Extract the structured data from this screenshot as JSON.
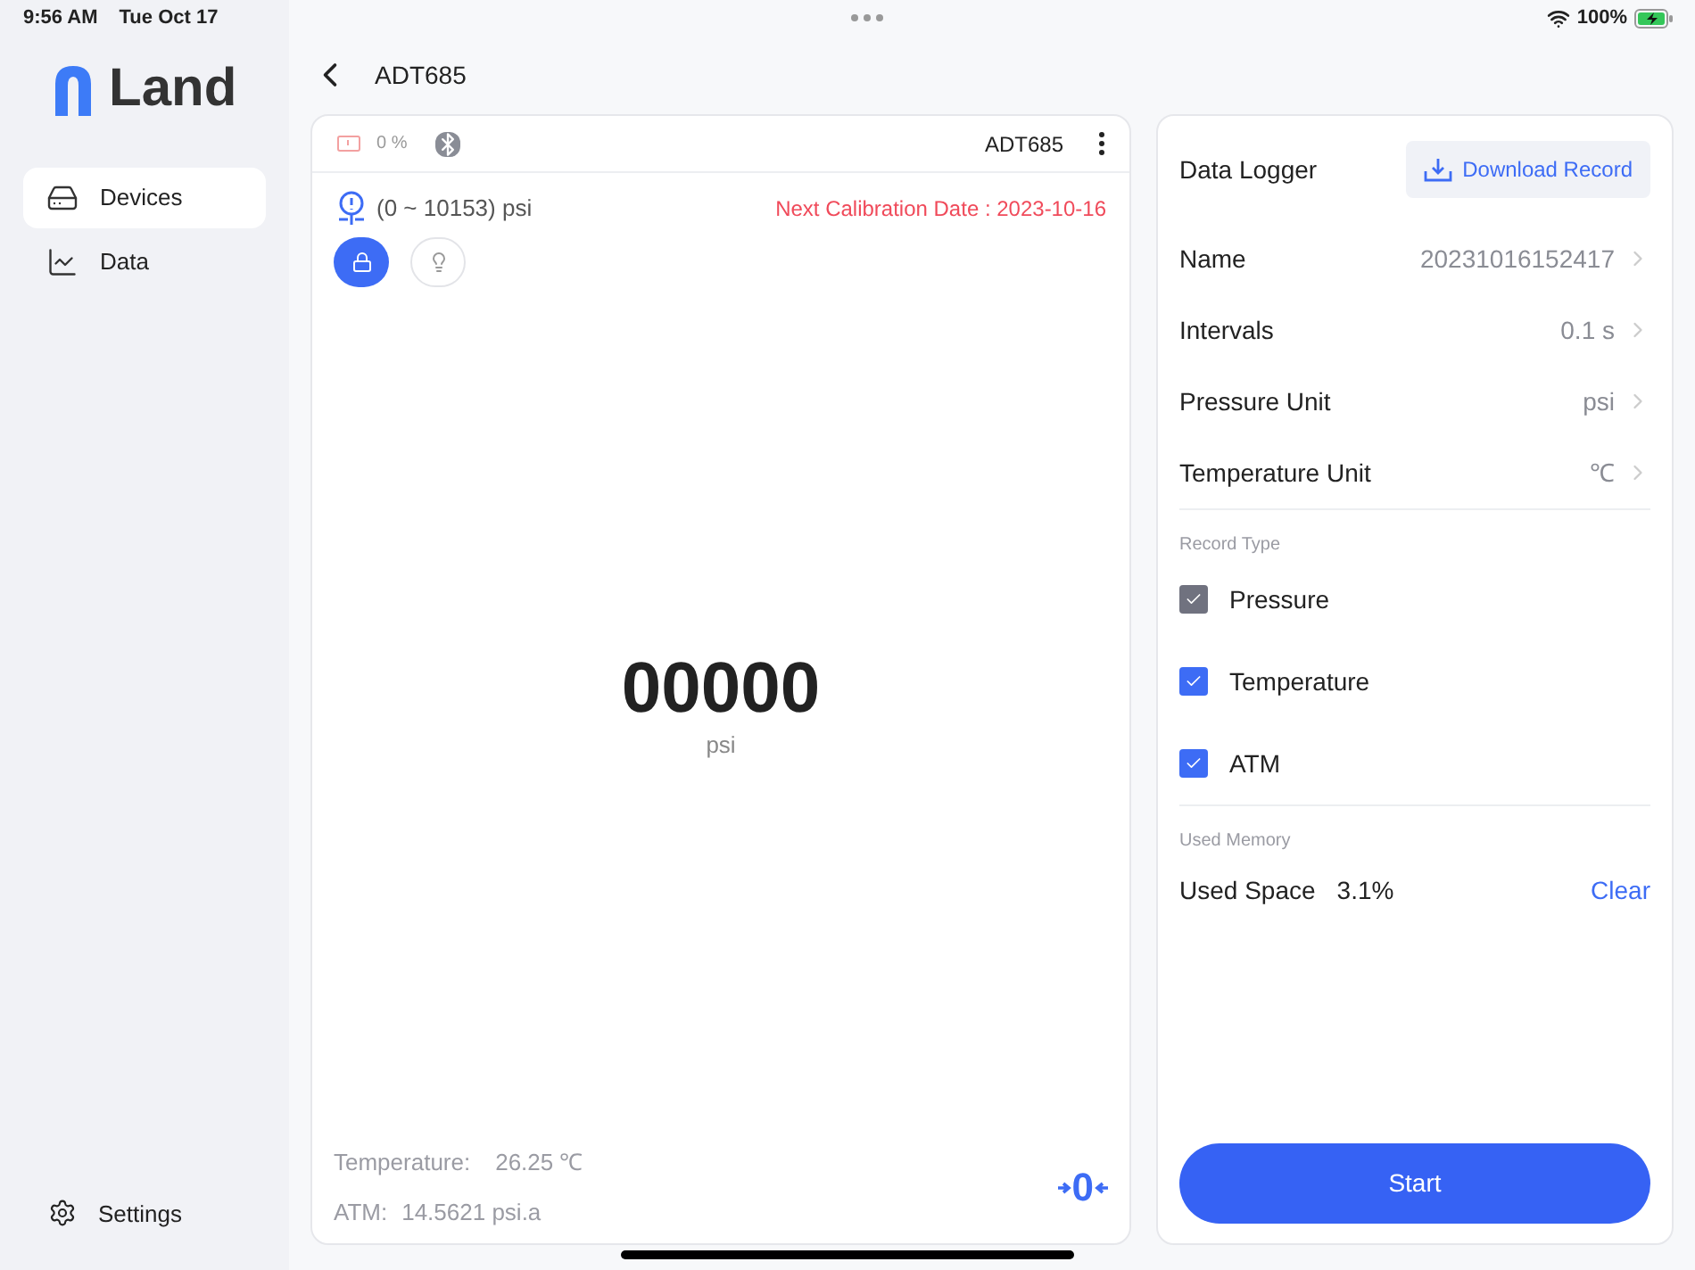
{
  "status_bar": {
    "time": "9:56 AM",
    "date": "Tue Oct 17",
    "battery": "100%"
  },
  "logo": {
    "text": "Land"
  },
  "sidebar": {
    "items": [
      {
        "label": "Devices",
        "selected": true
      },
      {
        "label": "Data",
        "selected": false
      }
    ],
    "settings": "Settings"
  },
  "header": {
    "title": "ADT685"
  },
  "device_panel": {
    "battery": "0 %",
    "device_name": "ADT685",
    "range": "(0 ~ 10153) psi",
    "calibration": "Next Calibration Date : 2023-10-16",
    "lock_on": true,
    "light_on": false,
    "reading": "00000",
    "unit": "psi",
    "temperature_label": "Temperature:",
    "temperature_value": "26.25 ℃",
    "atm_label": "ATM:",
    "atm_value": "14.5621 psi.a",
    "zero_button": "0"
  },
  "logger": {
    "title": "Data Logger",
    "download": "Download Record",
    "settings": [
      {
        "label": "Name",
        "value": "20231016152417"
      },
      {
        "label": "Intervals",
        "value": "0.1 s"
      },
      {
        "label": "Pressure Unit",
        "value": "psi"
      },
      {
        "label": "Temperature Unit",
        "value": "℃"
      }
    ],
    "record_type_heading": "Record Type",
    "record_types": [
      {
        "label": "Pressure",
        "checked": true,
        "disabled": true
      },
      {
        "label": "Temperature",
        "checked": true,
        "disabled": false
      },
      {
        "label": "ATM",
        "checked": true,
        "disabled": false
      }
    ],
    "memory_heading": "Used Memory",
    "used_space_label": "Used Space",
    "used_space_value": "3.1%",
    "clear": "Clear",
    "start": "Start"
  }
}
